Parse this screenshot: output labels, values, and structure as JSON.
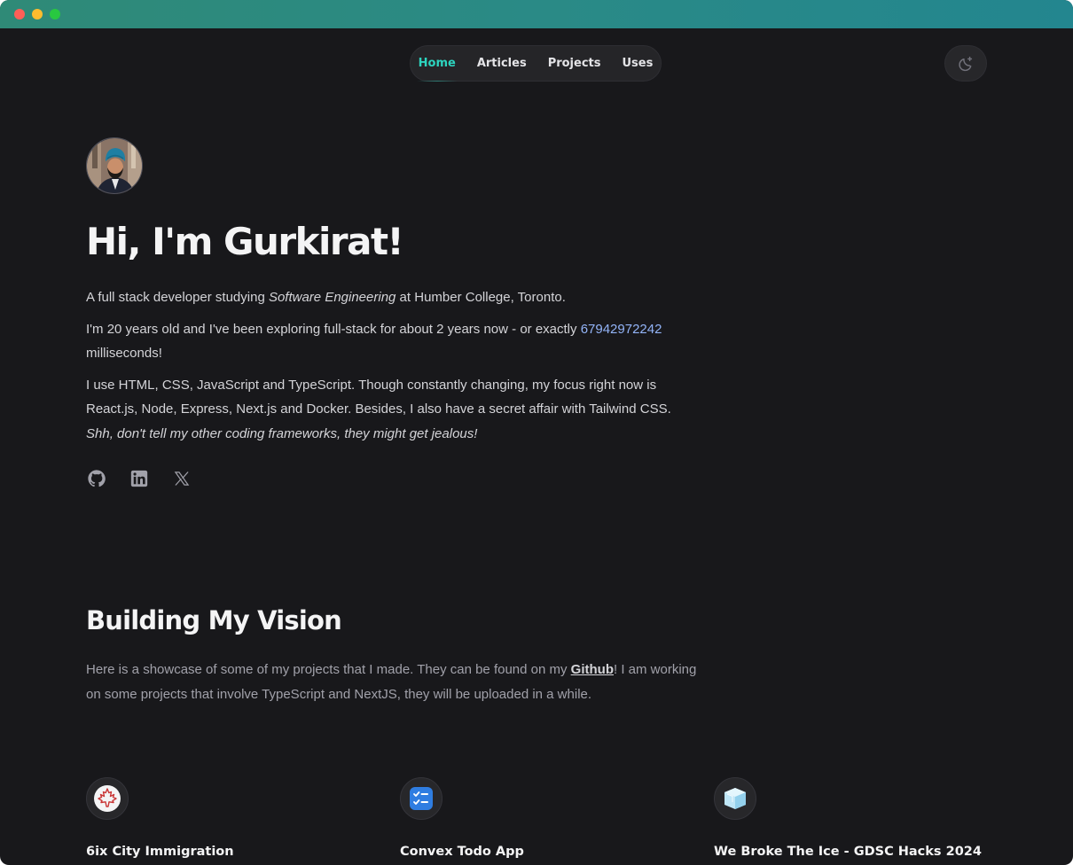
{
  "nav": {
    "items": [
      {
        "label": "Home",
        "active": true
      },
      {
        "label": "Articles",
        "active": false
      },
      {
        "label": "Projects",
        "active": false
      },
      {
        "label": "Uses",
        "active": false
      }
    ]
  },
  "theme_toggle": {
    "icon": "moon-sparkle-icon"
  },
  "hero": {
    "title": "Hi, I'm Gurkirat!",
    "p1_before": "A full stack developer studying ",
    "p1_em": "Software Engineering",
    "p1_after": " at Humber College, Toronto.",
    "p2_before": "I'm 20 years old and I've been exploring full-stack for about 2 years now - or exactly ",
    "p2_ms": "67942972242",
    "p2_after": " milliseconds!",
    "p3": "I use HTML, CSS, JavaScript and TypeScript. Though constantly changing, my focus right now is React.js, Node, Express, Next.js and Docker. Besides, I also have a secret affair with Tailwind CSS. ",
    "p3_em": "Shh, don't tell my other coding frameworks, they might get jealous!"
  },
  "socials": [
    {
      "icon": "github-icon"
    },
    {
      "icon": "linkedin-icon"
    },
    {
      "icon": "x-icon"
    }
  ],
  "projects_section": {
    "title": "Building My Vision",
    "text_before": "Here is a showcase of some of my projects that I made. They can be found on my ",
    "link": "Github",
    "text_after": "! I am working on some projects that involve TypeScript and NextJS, they will be uploaded in a while."
  },
  "projects": [
    {
      "name": "6ix City Immigration",
      "icon": "maple-leaf-icon"
    },
    {
      "name": "Convex Todo App",
      "icon": "todo-list-icon"
    },
    {
      "name": "We Broke The Ice - GDSC Hacks 2024",
      "icon": "ice-cube-icon"
    }
  ],
  "colors": {
    "background": "#18181b",
    "accent": "#2dd4bf",
    "link": "#93b4f8",
    "titlebar": "#2a8a86"
  }
}
